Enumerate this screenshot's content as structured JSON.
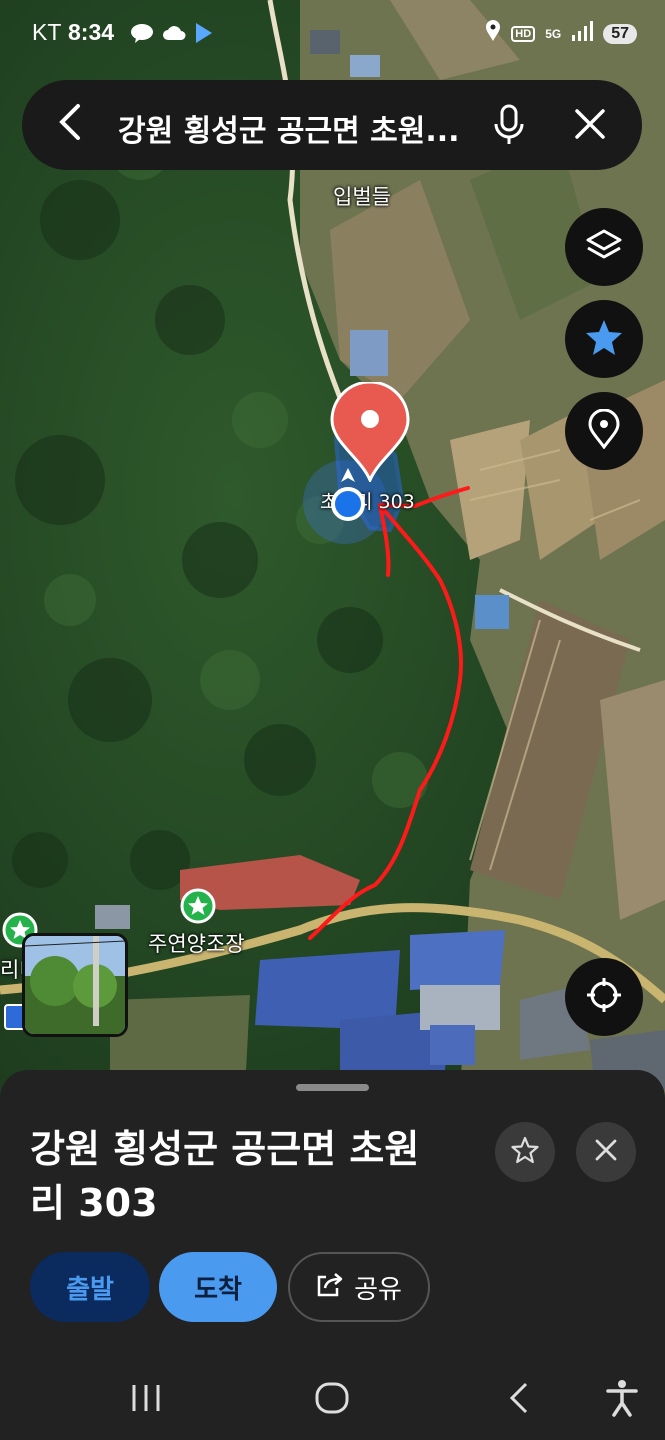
{
  "status_bar": {
    "carrier": "KT",
    "time": "8:34",
    "network": "5G",
    "battery": "57"
  },
  "search": {
    "query": "강원 횡성군 공근면 초원..."
  },
  "map": {
    "labels": {
      "ipbeoldeul": "입벌들",
      "pin_address": "초원리 303",
      "brewery": "주연양조장",
      "left_poi_partial": "리니"
    },
    "pin_color": "#e05a4f",
    "location_dot_color": "#1a73e8"
  },
  "place_sheet": {
    "title": "강원 횡성군 공근면 초원리 303",
    "buttons": {
      "departure": "출발",
      "arrival": "도착",
      "share": "공유"
    },
    "colors": {
      "departure_bg": "#0b2a5e",
      "arrival_bg": "#4a9bf0"
    }
  },
  "icons": [
    "back-arrow-icon",
    "microphone-icon",
    "close-icon",
    "layers-icon",
    "star-icon",
    "place-pin-icon",
    "gps-target-icon",
    "share-icon",
    "recents-icon",
    "home-icon",
    "nav-back-icon",
    "accessibility-icon"
  ]
}
